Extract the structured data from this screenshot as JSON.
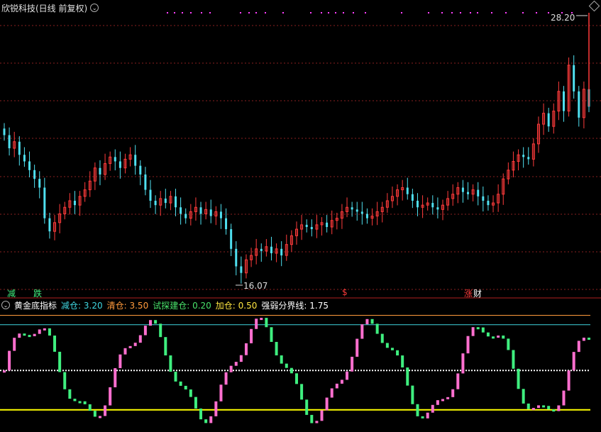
{
  "header": {
    "title": "欣锐科技(日线 前复权)"
  },
  "indicator": {
    "name": "黄金底指标",
    "items": [
      {
        "label": "减仓:",
        "value": "3.20",
        "color": "#3fd6e0"
      },
      {
        "label": "清仓:",
        "value": "3.50",
        "color": "#ff9a3c"
      },
      {
        "label": "试探建仓:",
        "value": "0.20",
        "color": "#49e36b"
      },
      {
        "label": "加仓:",
        "value": "0.50",
        "color": "#ffe640"
      },
      {
        "label": "强弱分界线:",
        "value": "1.75",
        "color": "#ffffff"
      }
    ]
  },
  "price_labels": {
    "high": "28.20",
    "low": "16.07"
  },
  "signals": {
    "reduce": "减",
    "fall": "跌",
    "dollar": "$",
    "rise": "涨",
    "wealth": "财"
  },
  "colors": {
    "up": "#ff3b3b",
    "down": "#4fe0f0",
    "grid": "#8a1f1f",
    "accent_magenta": "#ff40ff",
    "pink": "#ff6fcf",
    "green": "#3fef7f",
    "yellow": "#ffff00"
  },
  "chart_data": {
    "type": "candlestick",
    "price_range": [
      16.07,
      28.2
    ],
    "oscillator_levels": {
      "reduce": 3.2,
      "clear": 3.5,
      "probe_buy": 0.2,
      "add": 0.5,
      "divider": 1.75
    },
    "closes": [
      22.8,
      22.2,
      22.5,
      21.9,
      21.6,
      21.2,
      20.8,
      20.4,
      19.0,
      18.4,
      18.8,
      19.2,
      19.5,
      19.8,
      19.6,
      20.0,
      20.3,
      20.7,
      21.3,
      21.0,
      21.5,
      21.8,
      21.6,
      21.3,
      21.7,
      21.9,
      21.4,
      21.0,
      20.3,
      19.8,
      19.6,
      19.9,
      19.7,
      20.0,
      19.5,
      19.2,
      19.0,
      19.3,
      19.5,
      19.2,
      19.4,
      19.1,
      19.3,
      19.0,
      18.5,
      17.6,
      16.8,
      16.5,
      17.1,
      17.3,
      17.6,
      17.5,
      17.7,
      17.4,
      17.6,
      17.3,
      17.8,
      18.2,
      18.5,
      18.7,
      18.6,
      18.5,
      18.7,
      18.8,
      18.6,
      18.9,
      19.0,
      19.3,
      19.5,
      19.4,
      19.3,
      19.2,
      19.0,
      19.1,
      19.3,
      19.5,
      19.8,
      20.0,
      20.3,
      20.4,
      20.1,
      19.8,
      19.5,
      19.6,
      19.7,
      19.5,
      19.4,
      19.6,
      19.9,
      20.1,
      20.4,
      20.2,
      20.1,
      20.3,
      20.0,
      19.8,
      19.6,
      19.7,
      20.1,
      20.8,
      21.2,
      21.6,
      21.9,
      21.8,
      21.7,
      22.4,
      23.3,
      23.8,
      23.2,
      23.9,
      24.8,
      23.9,
      26.0,
      24.8,
      23.6,
      24.9,
      24.1
    ]
  }
}
